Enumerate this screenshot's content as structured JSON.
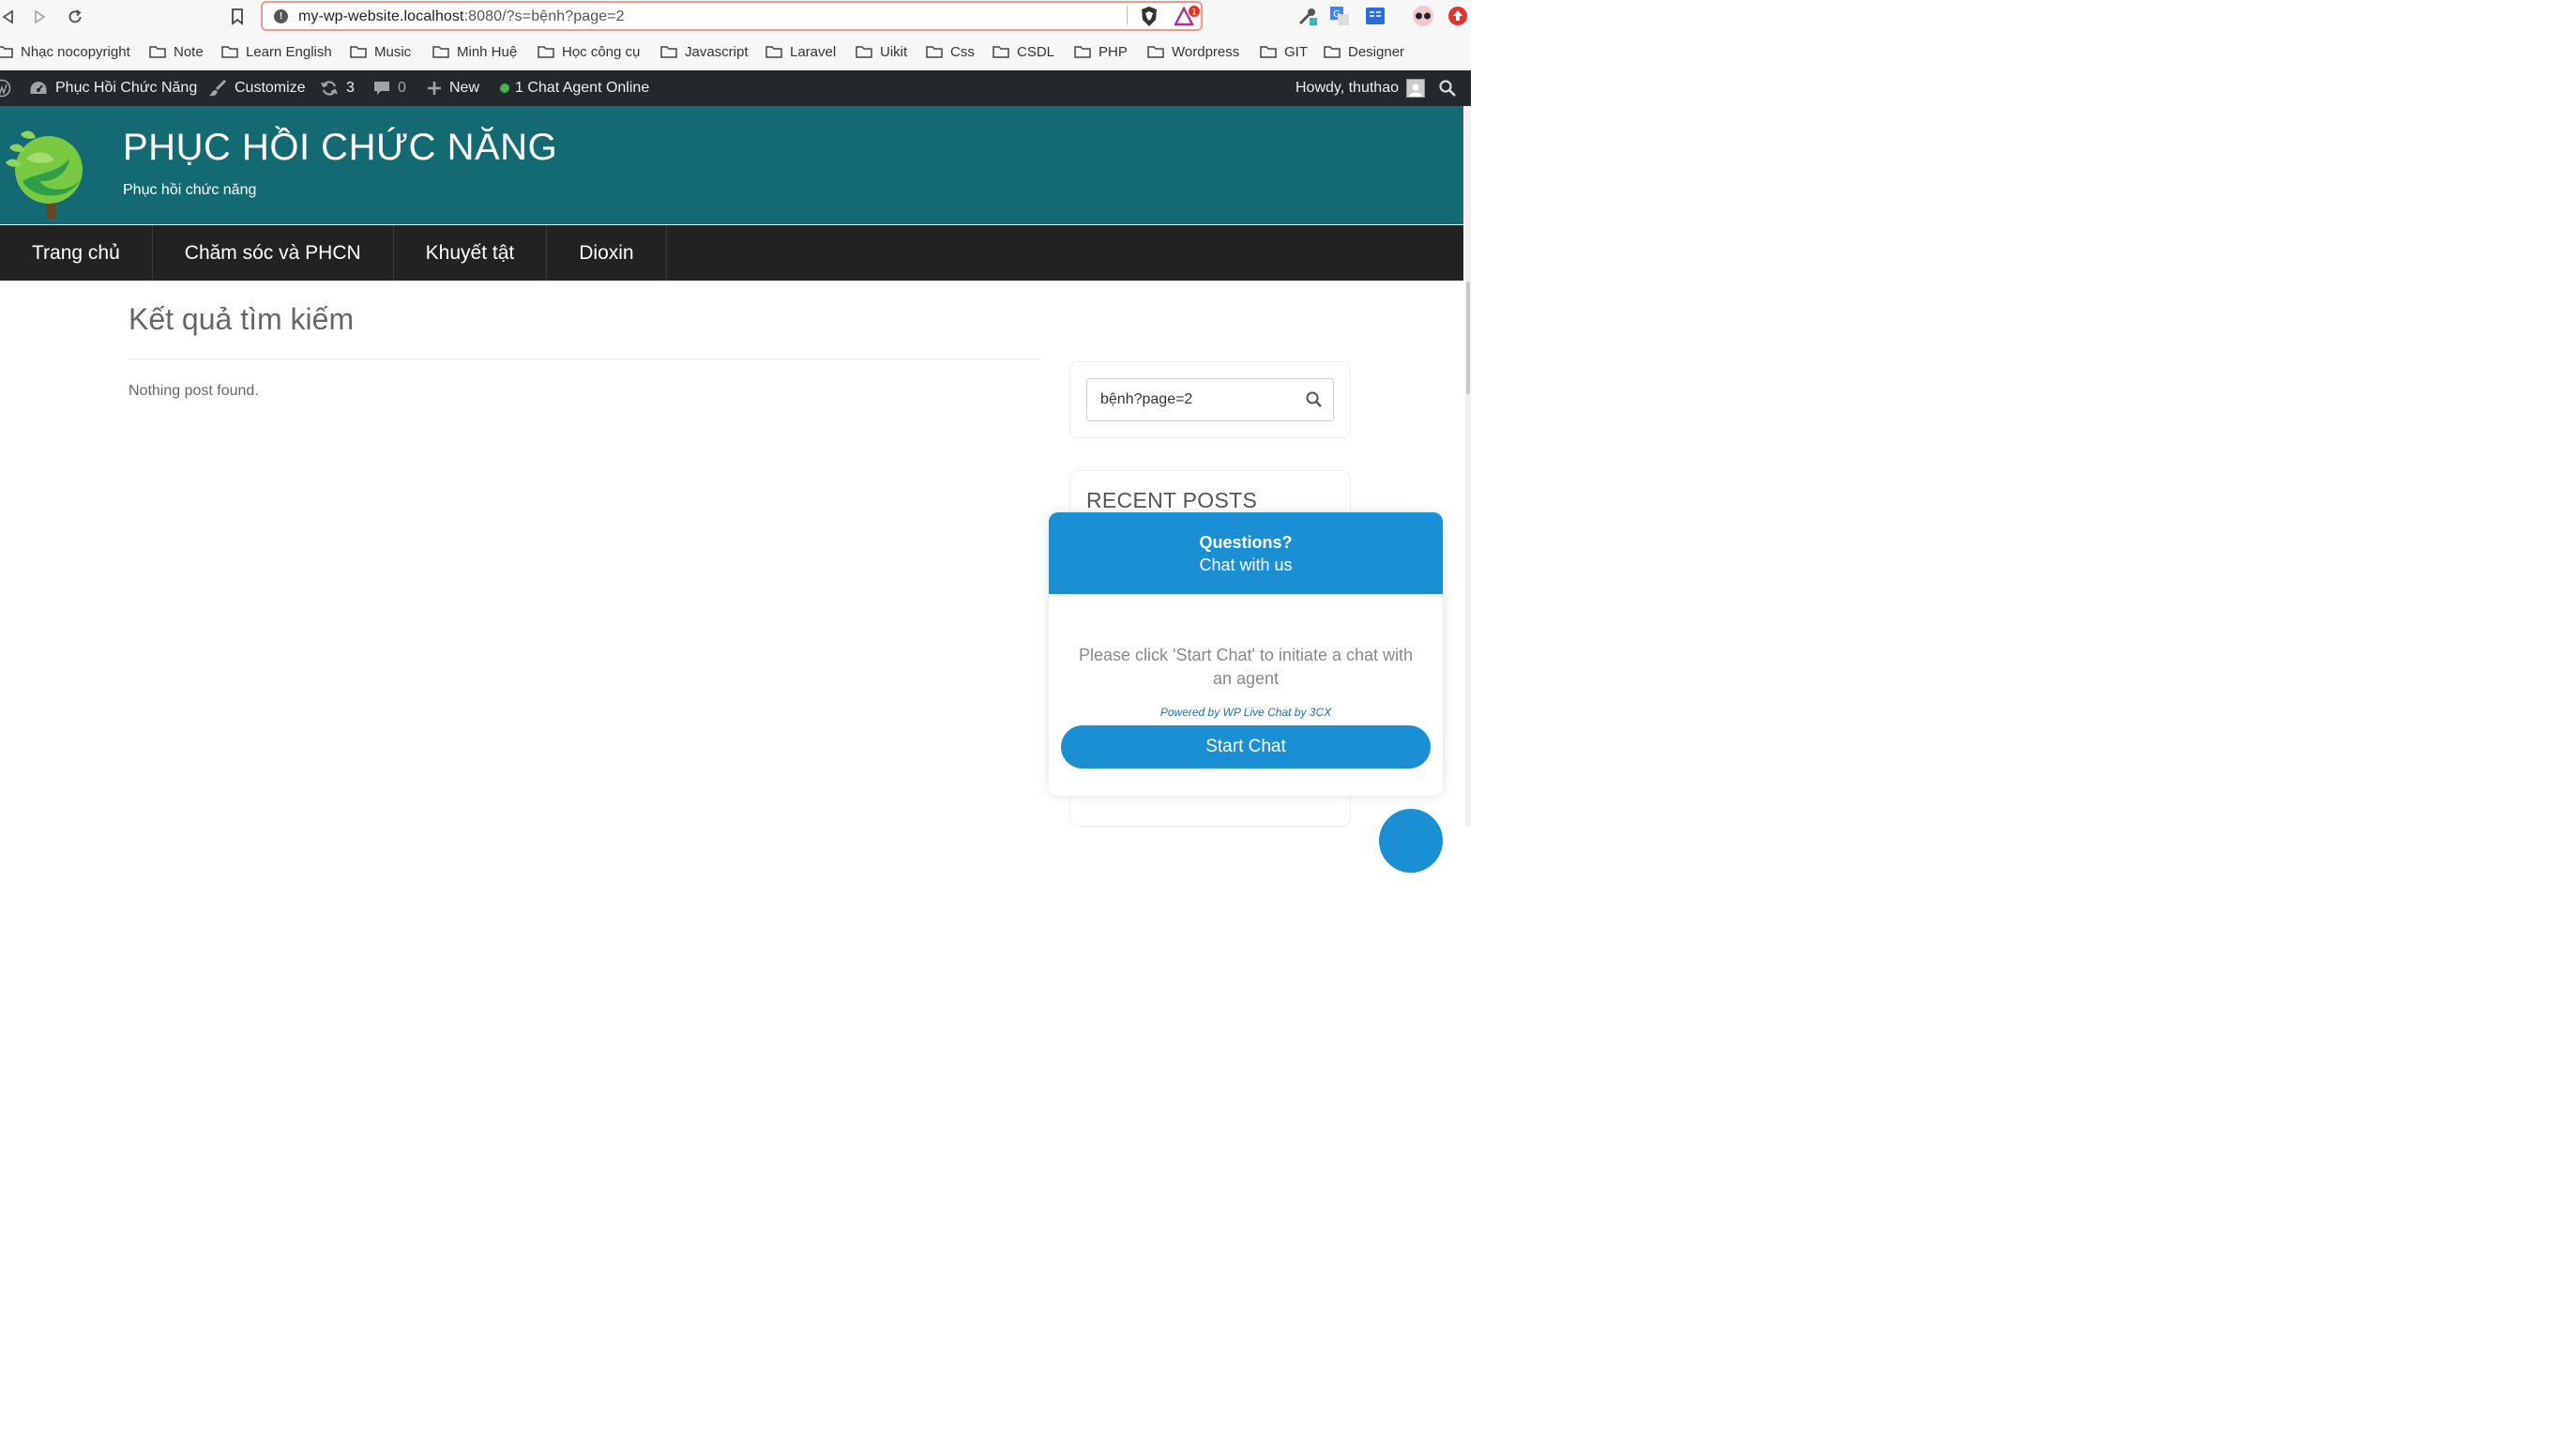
{
  "browser": {
    "url_host": "my-wp-website.localhost",
    "url_rest": ":8080/?s=bệnh?page=2",
    "bat_badge": "1"
  },
  "bookmarks": [
    "Nhạc nocopyright",
    "Note",
    "Learn English",
    "Music",
    "Minh Huệ",
    "Học công cụ",
    "Javascript",
    "Laravel",
    "Uikit",
    "Css",
    "CSDL",
    "PHP",
    "Wordpress",
    "GIT",
    "Designer"
  ],
  "admin_bar": {
    "site_name": "Phục Hồi Chức Năng",
    "customize": "Customize",
    "updates": "3",
    "comments": "0",
    "new": "New",
    "chat_status": "1 Chat Agent Online",
    "howdy": "Howdy, thuthao"
  },
  "site": {
    "title": "PHỤC HỒI CHỨC NĂNG",
    "tagline": "Phục hồi chức năng",
    "brand_color": "#136a72"
  },
  "nav": [
    "Trang chủ",
    "Chăm sóc và PHCN",
    "Khuyết tật",
    "Dioxin"
  ],
  "content": {
    "title": "Kết quả tìm kiếm",
    "message": "Nothing post found."
  },
  "sidebar": {
    "search_value": "bệnh?page=2",
    "recent_posts_title": "RECENT POSTS"
  },
  "chat": {
    "question": "Questions?",
    "subtitle": "Chat with us",
    "message": "Please click 'Start Chat' to initiate a chat with an agent",
    "powered": "Powered by WP Live Chat by 3CX",
    "start": "Start Chat",
    "accent": "#1b8fd3"
  }
}
